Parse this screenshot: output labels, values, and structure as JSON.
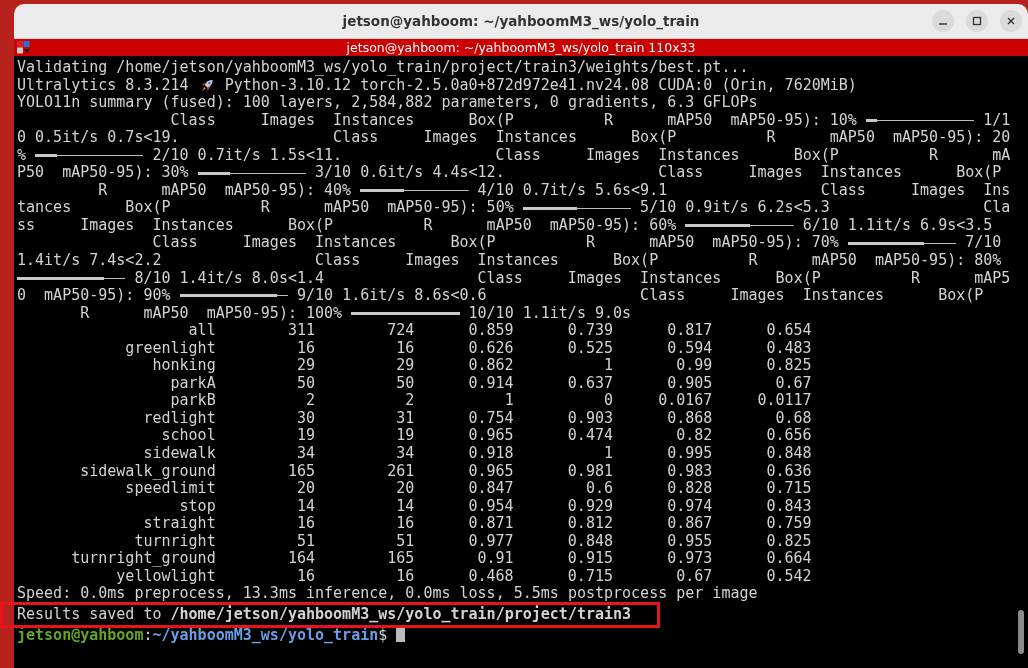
{
  "window": {
    "title": "jetson@yahboom: ~/yahboomM3_ws/yolo_train"
  },
  "terminal": {
    "title": "jetson@yahboom: ~/yahboomM3_ws/yolo_train 110x33",
    "lines": [
      {
        "segments": [
          {
            "kind": "text",
            "text": "Validating /home/jetson/yahboomM3_ws/yolo_train/project/train3/weights/best.pt..."
          }
        ]
      },
      {
        "segments": [
          {
            "kind": "text",
            "text": "Ultralytics 8.3.214"
          },
          {
            "kind": "rocket"
          },
          {
            "kind": "text",
            "text": "Python-3.10.12 torch-2.5.0a0+872d972e41.nv24.08 CUDA:0 (Orin, 7620MiB)"
          }
        ]
      },
      {
        "segments": [
          {
            "kind": "text",
            "text": "YOLO11n summary (fused): 100 layers, 2,584,882 parameters, 0 gradients, 6.3 GFLOPs"
          }
        ]
      },
      {
        "segments": [
          {
            "kind": "text",
            "text": "                 Class     Images  Instances      Box(P          R      mAP50  mAP50-95): 10% "
          },
          {
            "kind": "bar",
            "level": 0.1
          },
          {
            "kind": "text",
            "text": " 1/1"
          }
        ]
      },
      {
        "segments": [
          {
            "kind": "text",
            "text": "0 0.5it/s 0.7s<19.                 Class     Images  Instances      Box(P          R      mAP50  mAP50-95): 20"
          }
        ]
      },
      {
        "segments": [
          {
            "kind": "text",
            "text": "% "
          },
          {
            "kind": "bar",
            "level": 0.2
          },
          {
            "kind": "text",
            "text": " 2/10 0.7it/s 1.5s<11.                 Class     Images  Instances      Box(P          R      mA"
          }
        ]
      },
      {
        "segments": [
          {
            "kind": "text",
            "text": "P50  mAP50-95): 30% "
          },
          {
            "kind": "bar",
            "level": 0.3
          },
          {
            "kind": "text",
            "text": " 3/10 0.6it/s 4.4s<12.                 Class     Images  Instances      Box(P"
          }
        ]
      },
      {
        "segments": [
          {
            "kind": "text",
            "text": "         R      mAP50  mAP50-95): 40% "
          },
          {
            "kind": "bar",
            "level": 0.4
          },
          {
            "kind": "text",
            "text": " 4/10 0.7it/s 5.6s<9.1                 Class     Images  Ins"
          }
        ]
      },
      {
        "segments": [
          {
            "kind": "text",
            "text": "tances      Box(P          R      mAP50  mAP50-95): 50% "
          },
          {
            "kind": "bar",
            "level": 0.5
          },
          {
            "kind": "text",
            "text": " 5/10 0.9it/s 6.2s<5.3                 Cla"
          }
        ]
      },
      {
        "segments": [
          {
            "kind": "text",
            "text": "ss     Images  Instances      Box(P          R      mAP50  mAP50-95): 60% "
          },
          {
            "kind": "bar",
            "level": 0.6
          },
          {
            "kind": "text",
            "text": " 6/10 1.1it/s 6.9s<3.5"
          }
        ]
      },
      {
        "segments": [
          {
            "kind": "text",
            "text": "               Class     Images  Instances      Box(P          R      mAP50  mAP50-95): 70% "
          },
          {
            "kind": "bar",
            "level": 0.7
          },
          {
            "kind": "text",
            "text": " 7/10"
          }
        ]
      },
      {
        "segments": [
          {
            "kind": "text",
            "text": "1.4it/s 7.4s<2.2                 Class     Images  Instances      Box(P          R      mAP50  mAP50-95): 80%"
          }
        ]
      },
      {
        "segments": [
          {
            "kind": "bar",
            "level": 0.8
          },
          {
            "kind": "text",
            "text": " 8/10 1.4it/s 8.0s<1.4                 Class     Images  Instances      Box(P          R      mAP5"
          }
        ]
      },
      {
        "segments": [
          {
            "kind": "text",
            "text": "0  mAP50-95): 90% "
          },
          {
            "kind": "bar",
            "level": 0.9
          },
          {
            "kind": "text",
            "text": " 9/10 1.6it/s 8.6s<0.6                 Class     Images  Instances      Box(P"
          }
        ]
      },
      {
        "segments": [
          {
            "kind": "text",
            "text": "       R      mAP50  mAP50-95): 100% "
          },
          {
            "kind": "bar",
            "level": 1.0
          },
          {
            "kind": "text",
            "text": " 10/10 1.1it/s 9.0s"
          }
        ]
      }
    ],
    "table": {
      "rows": [
        [
          "all",
          "311",
          "724",
          "0.859",
          "0.739",
          "0.817",
          "0.654"
        ],
        [
          "greenlight",
          "16",
          "16",
          "0.626",
          "0.525",
          "0.594",
          "0.483"
        ],
        [
          "honking",
          "29",
          "29",
          "0.862",
          "1",
          "0.99",
          "0.825"
        ],
        [
          "parkA",
          "50",
          "50",
          "0.914",
          "0.637",
          "0.905",
          "0.67"
        ],
        [
          "parkB",
          "2",
          "2",
          "1",
          "0",
          "0.0167",
          "0.0117"
        ],
        [
          "redlight",
          "30",
          "31",
          "0.754",
          "0.903",
          "0.868",
          "0.68"
        ],
        [
          "school",
          "19",
          "19",
          "0.965",
          "0.474",
          "0.82",
          "0.656"
        ],
        [
          "sidewalk",
          "34",
          "34",
          "0.918",
          "1",
          "0.995",
          "0.848"
        ],
        [
          "sidewalk_ground",
          "165",
          "261",
          "0.965",
          "0.981",
          "0.983",
          "0.636"
        ],
        [
          "speedlimit",
          "20",
          "20",
          "0.847",
          "0.6",
          "0.828",
          "0.715"
        ],
        [
          "stop",
          "14",
          "14",
          "0.954",
          "0.929",
          "0.974",
          "0.843"
        ],
        [
          "straight",
          "16",
          "16",
          "0.871",
          "0.812",
          "0.867",
          "0.759"
        ],
        [
          "turnright",
          "51",
          "51",
          "0.977",
          "0.848",
          "0.955",
          "0.825"
        ],
        [
          "turnright_ground",
          "164",
          "165",
          "0.91",
          "0.915",
          "0.973",
          "0.664"
        ],
        [
          "yellowlight",
          "16",
          "16",
          "0.468",
          "0.715",
          "0.67",
          "0.542"
        ]
      ]
    },
    "speed": "Speed: 0.0ms preprocess, 13.3ms inference, 0.0ms loss, 5.5ms postprocess per image",
    "results": {
      "text": "Results saved to **/home/jetson/yahboomM3_ws/yolo_train/project/train3**",
      "highlighted": true
    },
    "prompt": {
      "user": "jetson@yahboom",
      "separator": ":",
      "path": "~/yahboomM3_ws/yolo_train",
      "symbol": "$"
    }
  }
}
